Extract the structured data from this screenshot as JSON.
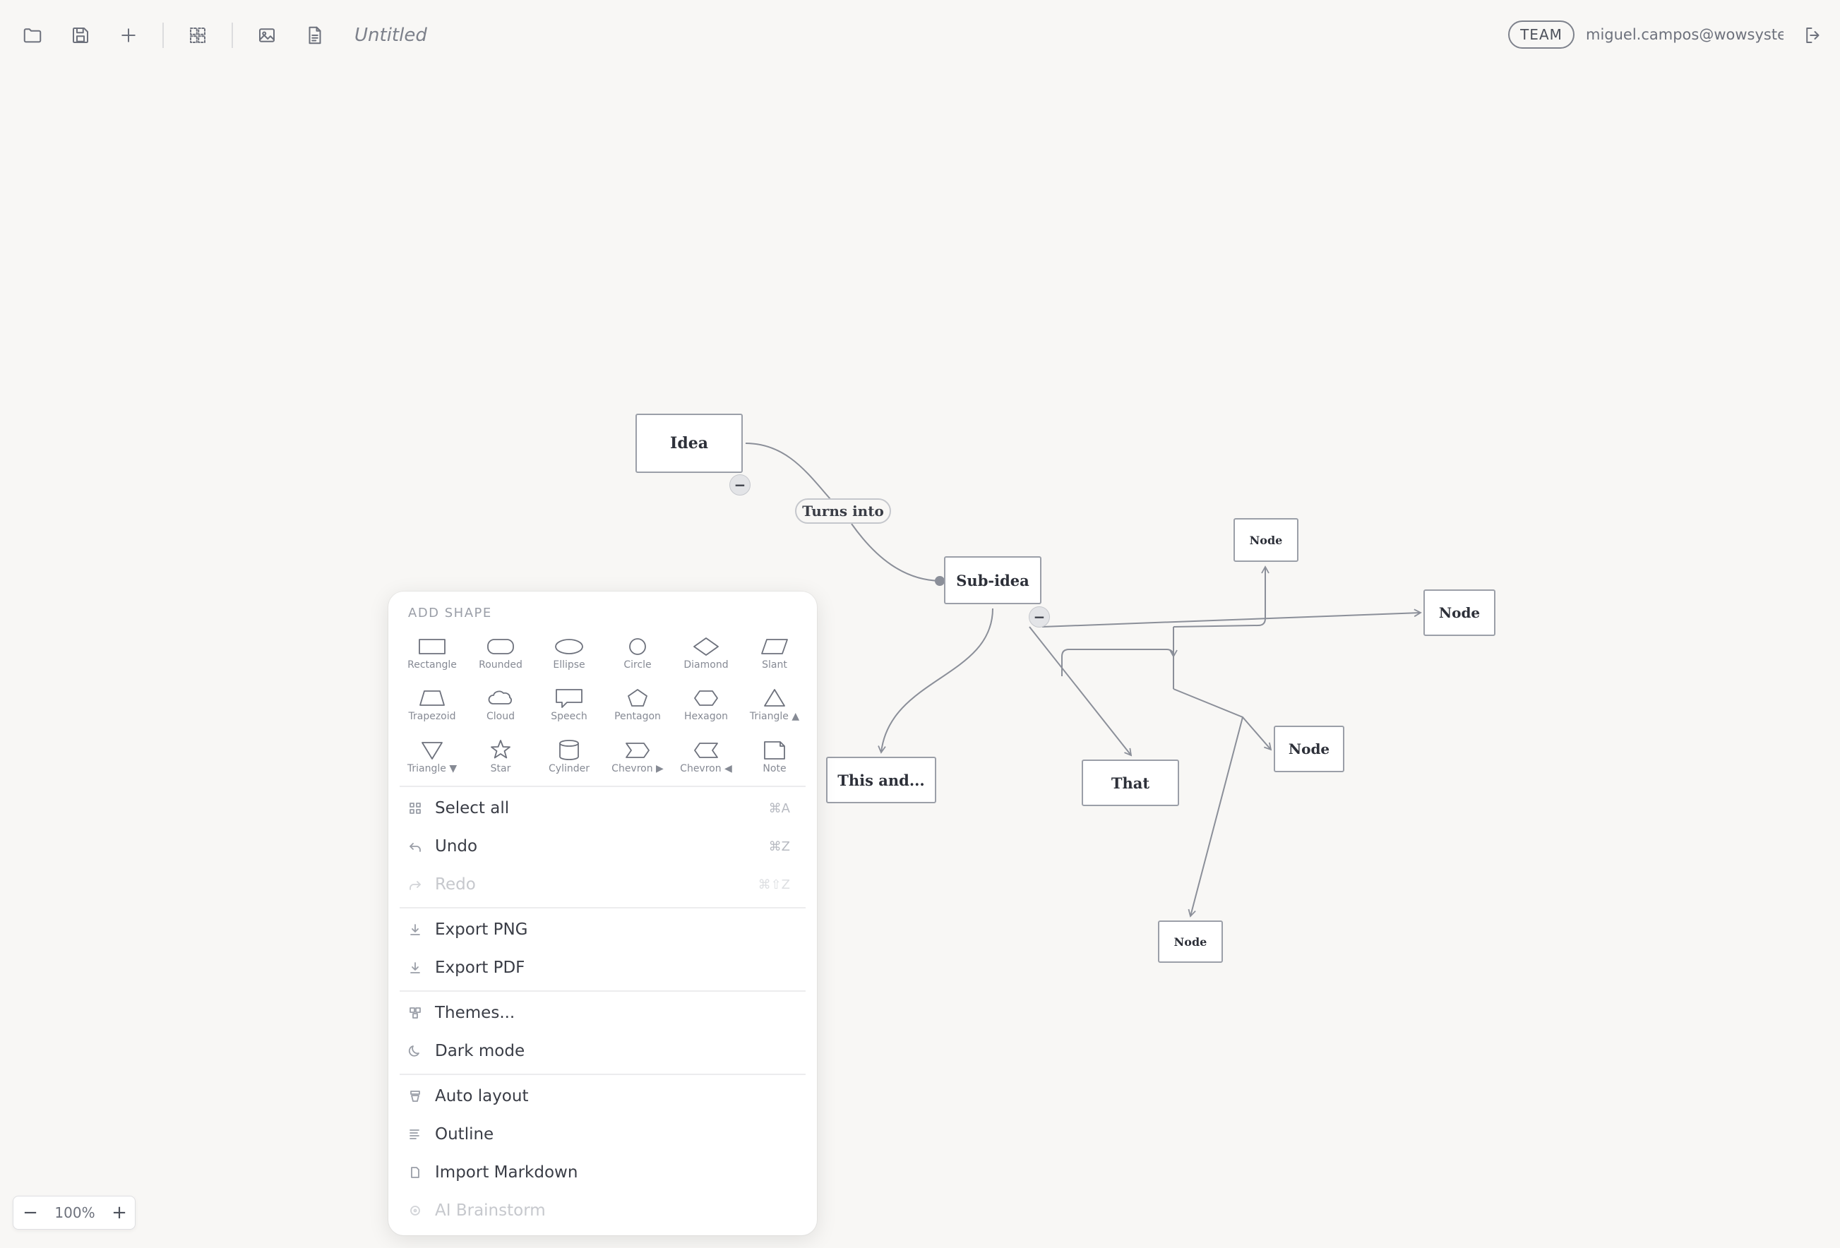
{
  "toolbar": {
    "doc_title": "Untitled",
    "team_label": "TEAM",
    "user_email": "miguel.campos@wowsystem..."
  },
  "canvas": {
    "nodes": {
      "idea": "Idea",
      "sub_idea": "Sub-idea",
      "this_and": "This and...",
      "that": "That",
      "node_top": "Node",
      "node_right": "Node",
      "node_mid": "Node",
      "node_bottom": "Node"
    },
    "edge_label": "Turns into",
    "collapse_symbol": "−"
  },
  "menu": {
    "heading": "ADD SHAPE",
    "shapes": [
      {
        "label": "Rectangle"
      },
      {
        "label": "Rounded"
      },
      {
        "label": "Ellipse"
      },
      {
        "label": "Circle"
      },
      {
        "label": "Diamond"
      },
      {
        "label": "Slant"
      },
      {
        "label": "Trapezoid"
      },
      {
        "label": "Cloud"
      },
      {
        "label": "Speech"
      },
      {
        "label": "Pentagon"
      },
      {
        "label": "Hexagon"
      },
      {
        "label": "Triangle ▲"
      },
      {
        "label": "Triangle ▼"
      },
      {
        "label": "Star"
      },
      {
        "label": "Cylinder"
      },
      {
        "label": "Chevron ▶"
      },
      {
        "label": "Chevron ◀"
      },
      {
        "label": "Note"
      }
    ],
    "items": {
      "select_all": {
        "label": "Select all",
        "shortcut": "⌘A"
      },
      "undo": {
        "label": "Undo",
        "shortcut": "⌘Z"
      },
      "redo": {
        "label": "Redo",
        "shortcut": "⌘⇧Z"
      },
      "export_png": {
        "label": "Export PNG"
      },
      "export_pdf": {
        "label": "Export PDF"
      },
      "themes": {
        "label": "Themes..."
      },
      "dark_mode": {
        "label": "Dark mode"
      },
      "auto_layout": {
        "label": "Auto layout"
      },
      "outline": {
        "label": "Outline"
      },
      "import_markdown": {
        "label": "Import Markdown"
      },
      "ai_brainstorm": {
        "label": "AI Brainstorm"
      }
    }
  },
  "zoom": {
    "minus": "−",
    "value": "100%",
    "plus": "+"
  }
}
